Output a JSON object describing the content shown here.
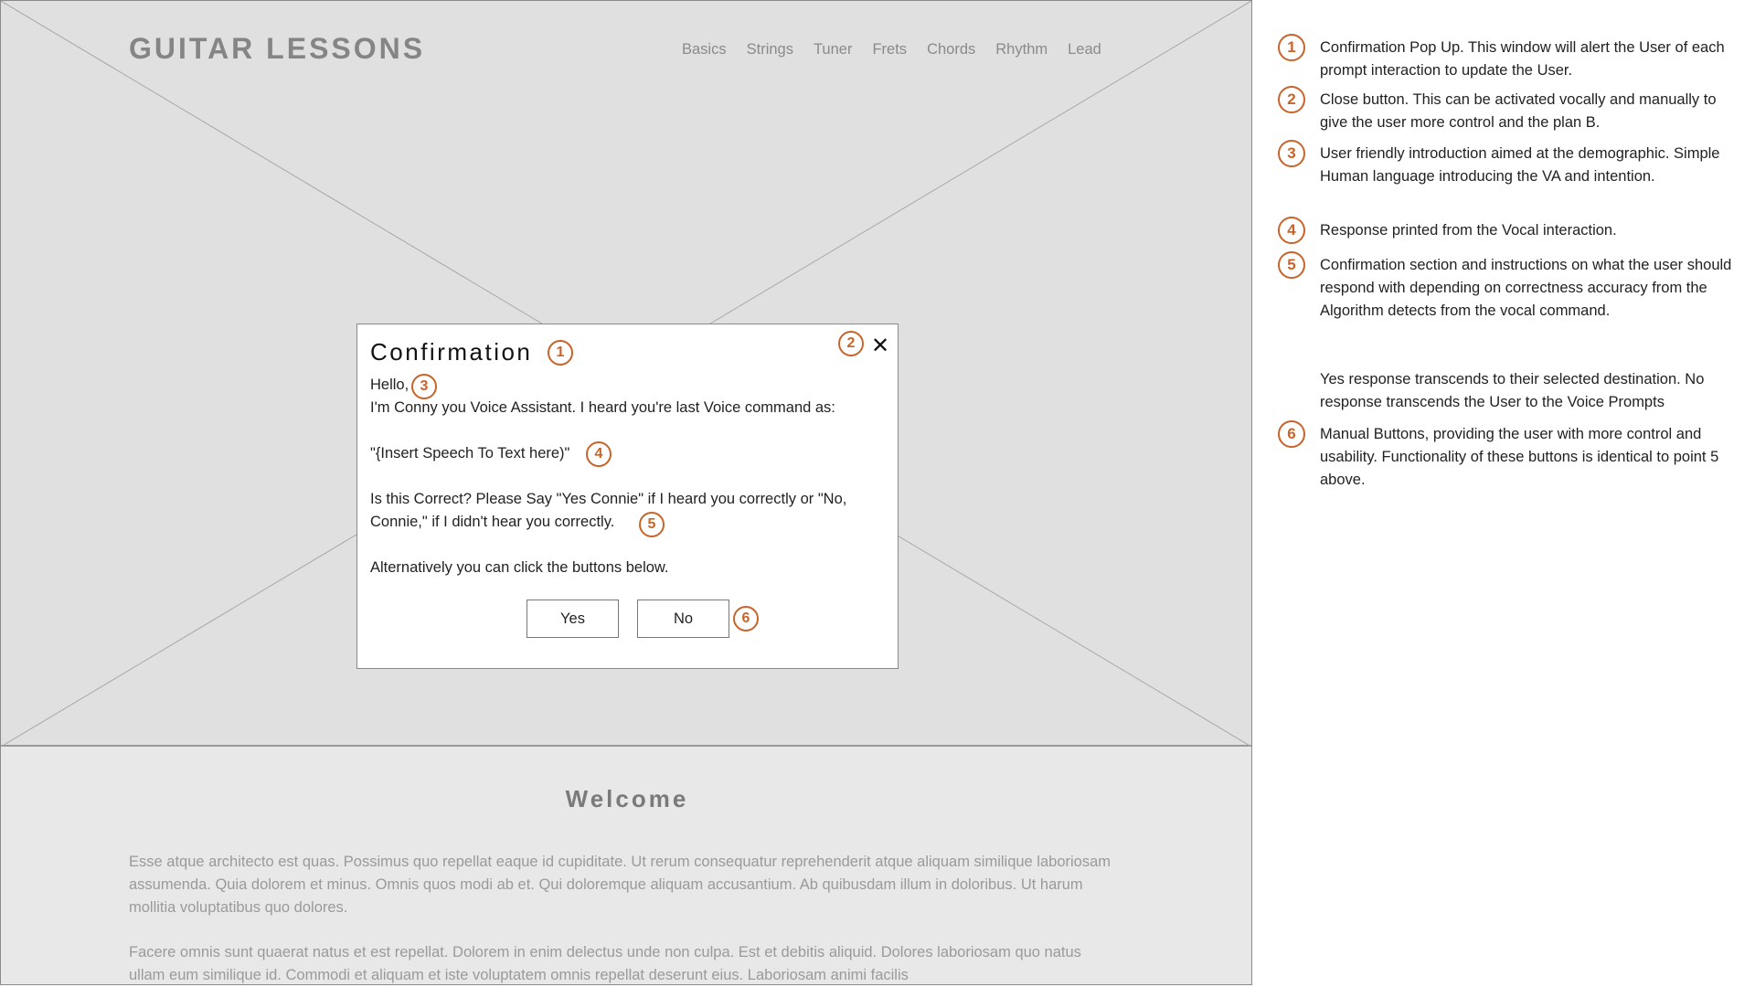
{
  "site": {
    "title": "GUITAR LESSONS",
    "nav": [
      "Basics",
      "Strings",
      "Tuner",
      "Frets",
      "Chords",
      "Rhythm",
      "Lead"
    ]
  },
  "dialog": {
    "title": "Confirmation",
    "greeting": "Hello,",
    "intro": " I'm Conny you Voice Assistant. I heard you're last Voice command as:",
    "speech": "\"{Insert Speech To Text here)\"",
    "question_line1": "Is this Correct? Please Say \"Yes Connie\" if I heard you correctly or \"No,",
    "question_line2": "Connie,\" if I didn't hear you correctly.",
    "alternative": "Alternatively you can click the buttons below.",
    "yes_label": "Yes",
    "no_label": "No",
    "close_icon": "close-icon"
  },
  "welcome": {
    "heading": "Welcome",
    "paragraph1": "Esse atque architecto est quas. Possimus quo repellat eaque id cupiditate. Ut rerum consequatur reprehenderit atque aliquam similique laboriosam assumenda. Quia dolorem et minus. Omnis quos modi ab et. Qui doloremque aliquam accusantium. Ab quibusdam illum in doloribus. Ut harum mollitia voluptatibus quo dolores.",
    "paragraph2": "Facere omnis sunt quaerat natus et est repellat. Dolorem in enim delectus unde non culpa. Est et debitis aliquid. Dolores laboriosam quo natus ullam eum similique id. Commodi et aliquam et iste voluptatem omnis repellat deserunt eius. Laboriosam animi facilis"
  },
  "badges": [
    "1",
    "2",
    "3",
    "4",
    "5",
    "6"
  ],
  "annotations": [
    {
      "num": "1",
      "text": "Confirmation Pop Up. This window will alert the User of each prompt interaction to update the User."
    },
    {
      "num": "2",
      "text": "Close button. This can be activated vocally and manually to give the user more control and the plan B."
    },
    {
      "num": "3",
      "text": "User friendly introduction aimed at the demographic. Simple Human language introducing the VA and intention."
    },
    {
      "num": "4",
      "text": " Response printed from the Vocal interaction."
    },
    {
      "num": "5",
      "text": "Confirmation section and instructions on what the user should respond with depending on correctness accuracy from the Algorithm detects from the vocal command."
    },
    {
      "num": "",
      "text": "Yes response transcends to their selected destination. No response transcends the User to the Voice Prompts"
    },
    {
      "num": "6",
      "text": "Manual Buttons, providing the user with more control and usability. Functionality of these buttons is identical to point 5 above."
    }
  ],
  "colors": {
    "accent": "#c8642a",
    "hero_bg": "#e0e0e0",
    "page_bg": "#e8e8e8"
  }
}
